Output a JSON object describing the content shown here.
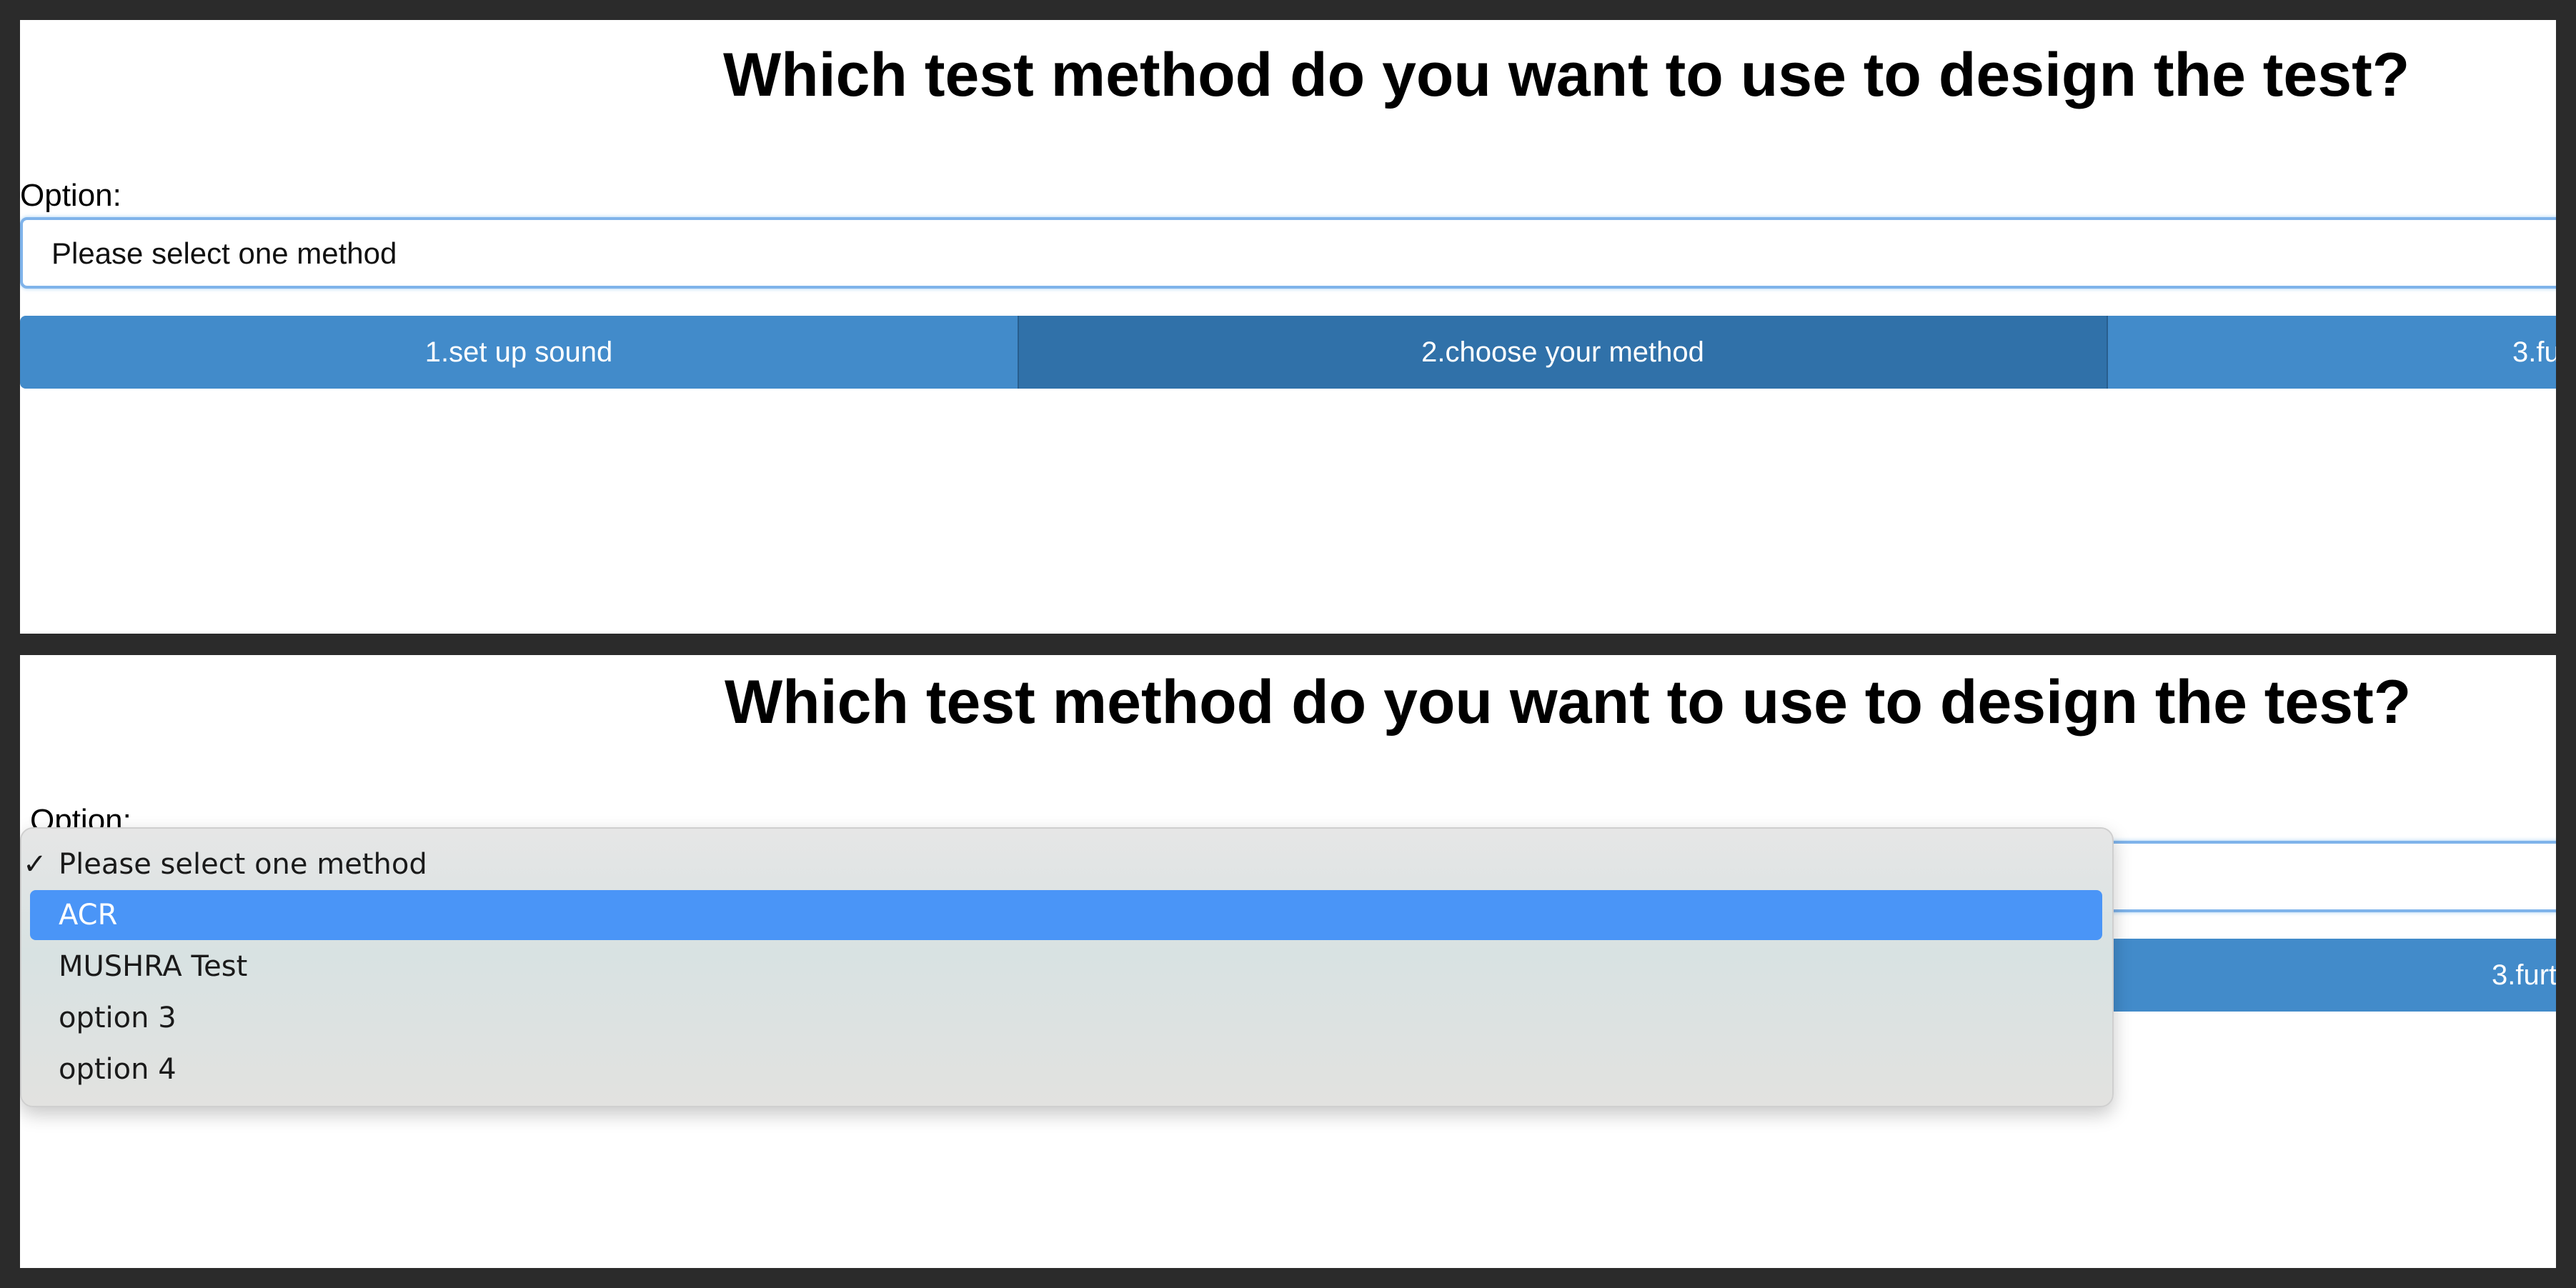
{
  "top_panel": {
    "title": "Which test method do you want to use to design the test?",
    "option_label": "Option:",
    "select_value": "Please select one method",
    "steps": [
      {
        "label": "1.set up sound"
      },
      {
        "label": "2.choose your method"
      },
      {
        "label": "3.fu"
      }
    ]
  },
  "bottom_panel": {
    "title": "Which test method do you want to use to design the test?",
    "option_label": "Option:",
    "select_value": "",
    "steps": [
      {
        "label": ""
      },
      {
        "label": ""
      },
      {
        "label": "3.furt"
      }
    ],
    "dropdown": {
      "check_mark": "✓",
      "options": [
        {
          "label": "Please select one method",
          "checked": true
        },
        {
          "label": "ACR",
          "highlighted": true
        },
        {
          "label": "MUSHRA Test"
        },
        {
          "label": "option 3"
        },
        {
          "label": "option 4"
        }
      ]
    }
  },
  "colors": {
    "step_bg": "#428bca",
    "step_active_bg": "#3071a9",
    "dropdown_highlight": "#4a95f7",
    "select_border": "#7fb3ea"
  }
}
